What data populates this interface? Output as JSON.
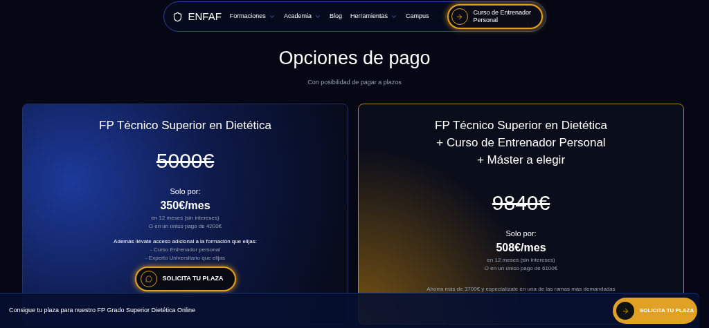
{
  "nav": {
    "brand": "ENFAF",
    "items": [
      {
        "label": "Formaciones",
        "dropdown": true
      },
      {
        "label": "Academia",
        "dropdown": true
      },
      {
        "label": "Blog",
        "dropdown": false
      },
      {
        "label": "Herramientas",
        "dropdown": true
      },
      {
        "label": "Campus",
        "dropdown": false
      }
    ],
    "cta": "Curso de Entrenador Personal"
  },
  "heading": {
    "title": "Opciones de pago",
    "subtitle": "Con posibilidad de pagar a plazos"
  },
  "plans": [
    {
      "kind": "basic",
      "title_lines": [
        "FP Técnico Superior en Dietética"
      ],
      "old_price": "5000€",
      "only_for": "Solo por:",
      "price": "350€/mes",
      "terms": "en 12 meses (sin intereses)",
      "single": "O en un único pago de 4200€",
      "extra_title": "Además llévate acceso adicional a la formación que elijas:",
      "extra_items": [
        "- Curso Entrenador personal",
        "- Experto Universitario que elijas"
      ],
      "button": "SOLICITA TU PLAZA"
    },
    {
      "kind": "premium",
      "title_lines": [
        "FP Técnico Superior en Dietética",
        "+ Curso de Entrenador Personal",
        "+ Máster a elegir"
      ],
      "old_price": "9840€",
      "only_for": "Solo por:",
      "price": "508€/mes",
      "terms": "en 12 meses (sin intereses)",
      "single": "O en un único pago de 6100€",
      "note": "Ahorra más de 3700€ y especialízate en una de las ramas más demandadas"
    }
  ],
  "bottom_bar": {
    "text": "Consigue tu plaza para nuestro FP Grado Superior Dietética Online",
    "button": "SOLICITA TU PLAZA"
  }
}
